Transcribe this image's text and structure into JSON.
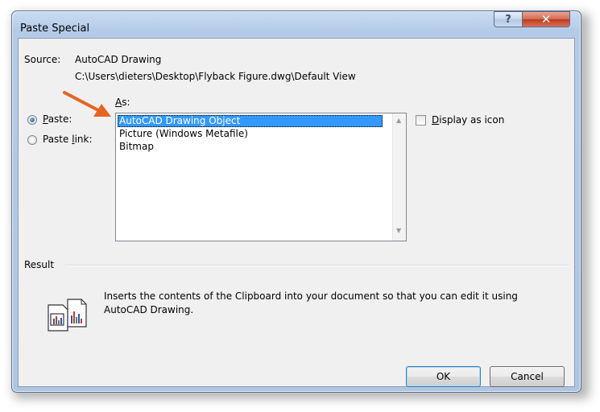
{
  "window": {
    "title": "Paste Special",
    "help_icon": "question-mark-icon",
    "close_icon": "close-icon"
  },
  "source": {
    "label": "Source:",
    "name": "AutoCAD Drawing",
    "path": "C:\\Users\\dieters\\Desktop\\Flyback Figure.dwg\\Default View"
  },
  "as_label": "As:",
  "options": {
    "paste": "Paste:",
    "paste_link": "Paste link:",
    "selected": "paste"
  },
  "list": {
    "items": [
      "AutoCAD Drawing Object",
      "Picture (Windows Metafile)",
      "Bitmap"
    ],
    "selected_index": 0
  },
  "display_as_icon": {
    "label": "Display as icon",
    "checked": false
  },
  "result": {
    "heading": "Result",
    "line1": "Inserts the contents of the Clipboard into your document so that you can edit it using",
    "line2": "AutoCAD Drawing."
  },
  "buttons": {
    "ok": "OK",
    "cancel": "Cancel"
  },
  "colors": {
    "annotation_arrow": "#e6651f",
    "selection": "#3399ff"
  }
}
